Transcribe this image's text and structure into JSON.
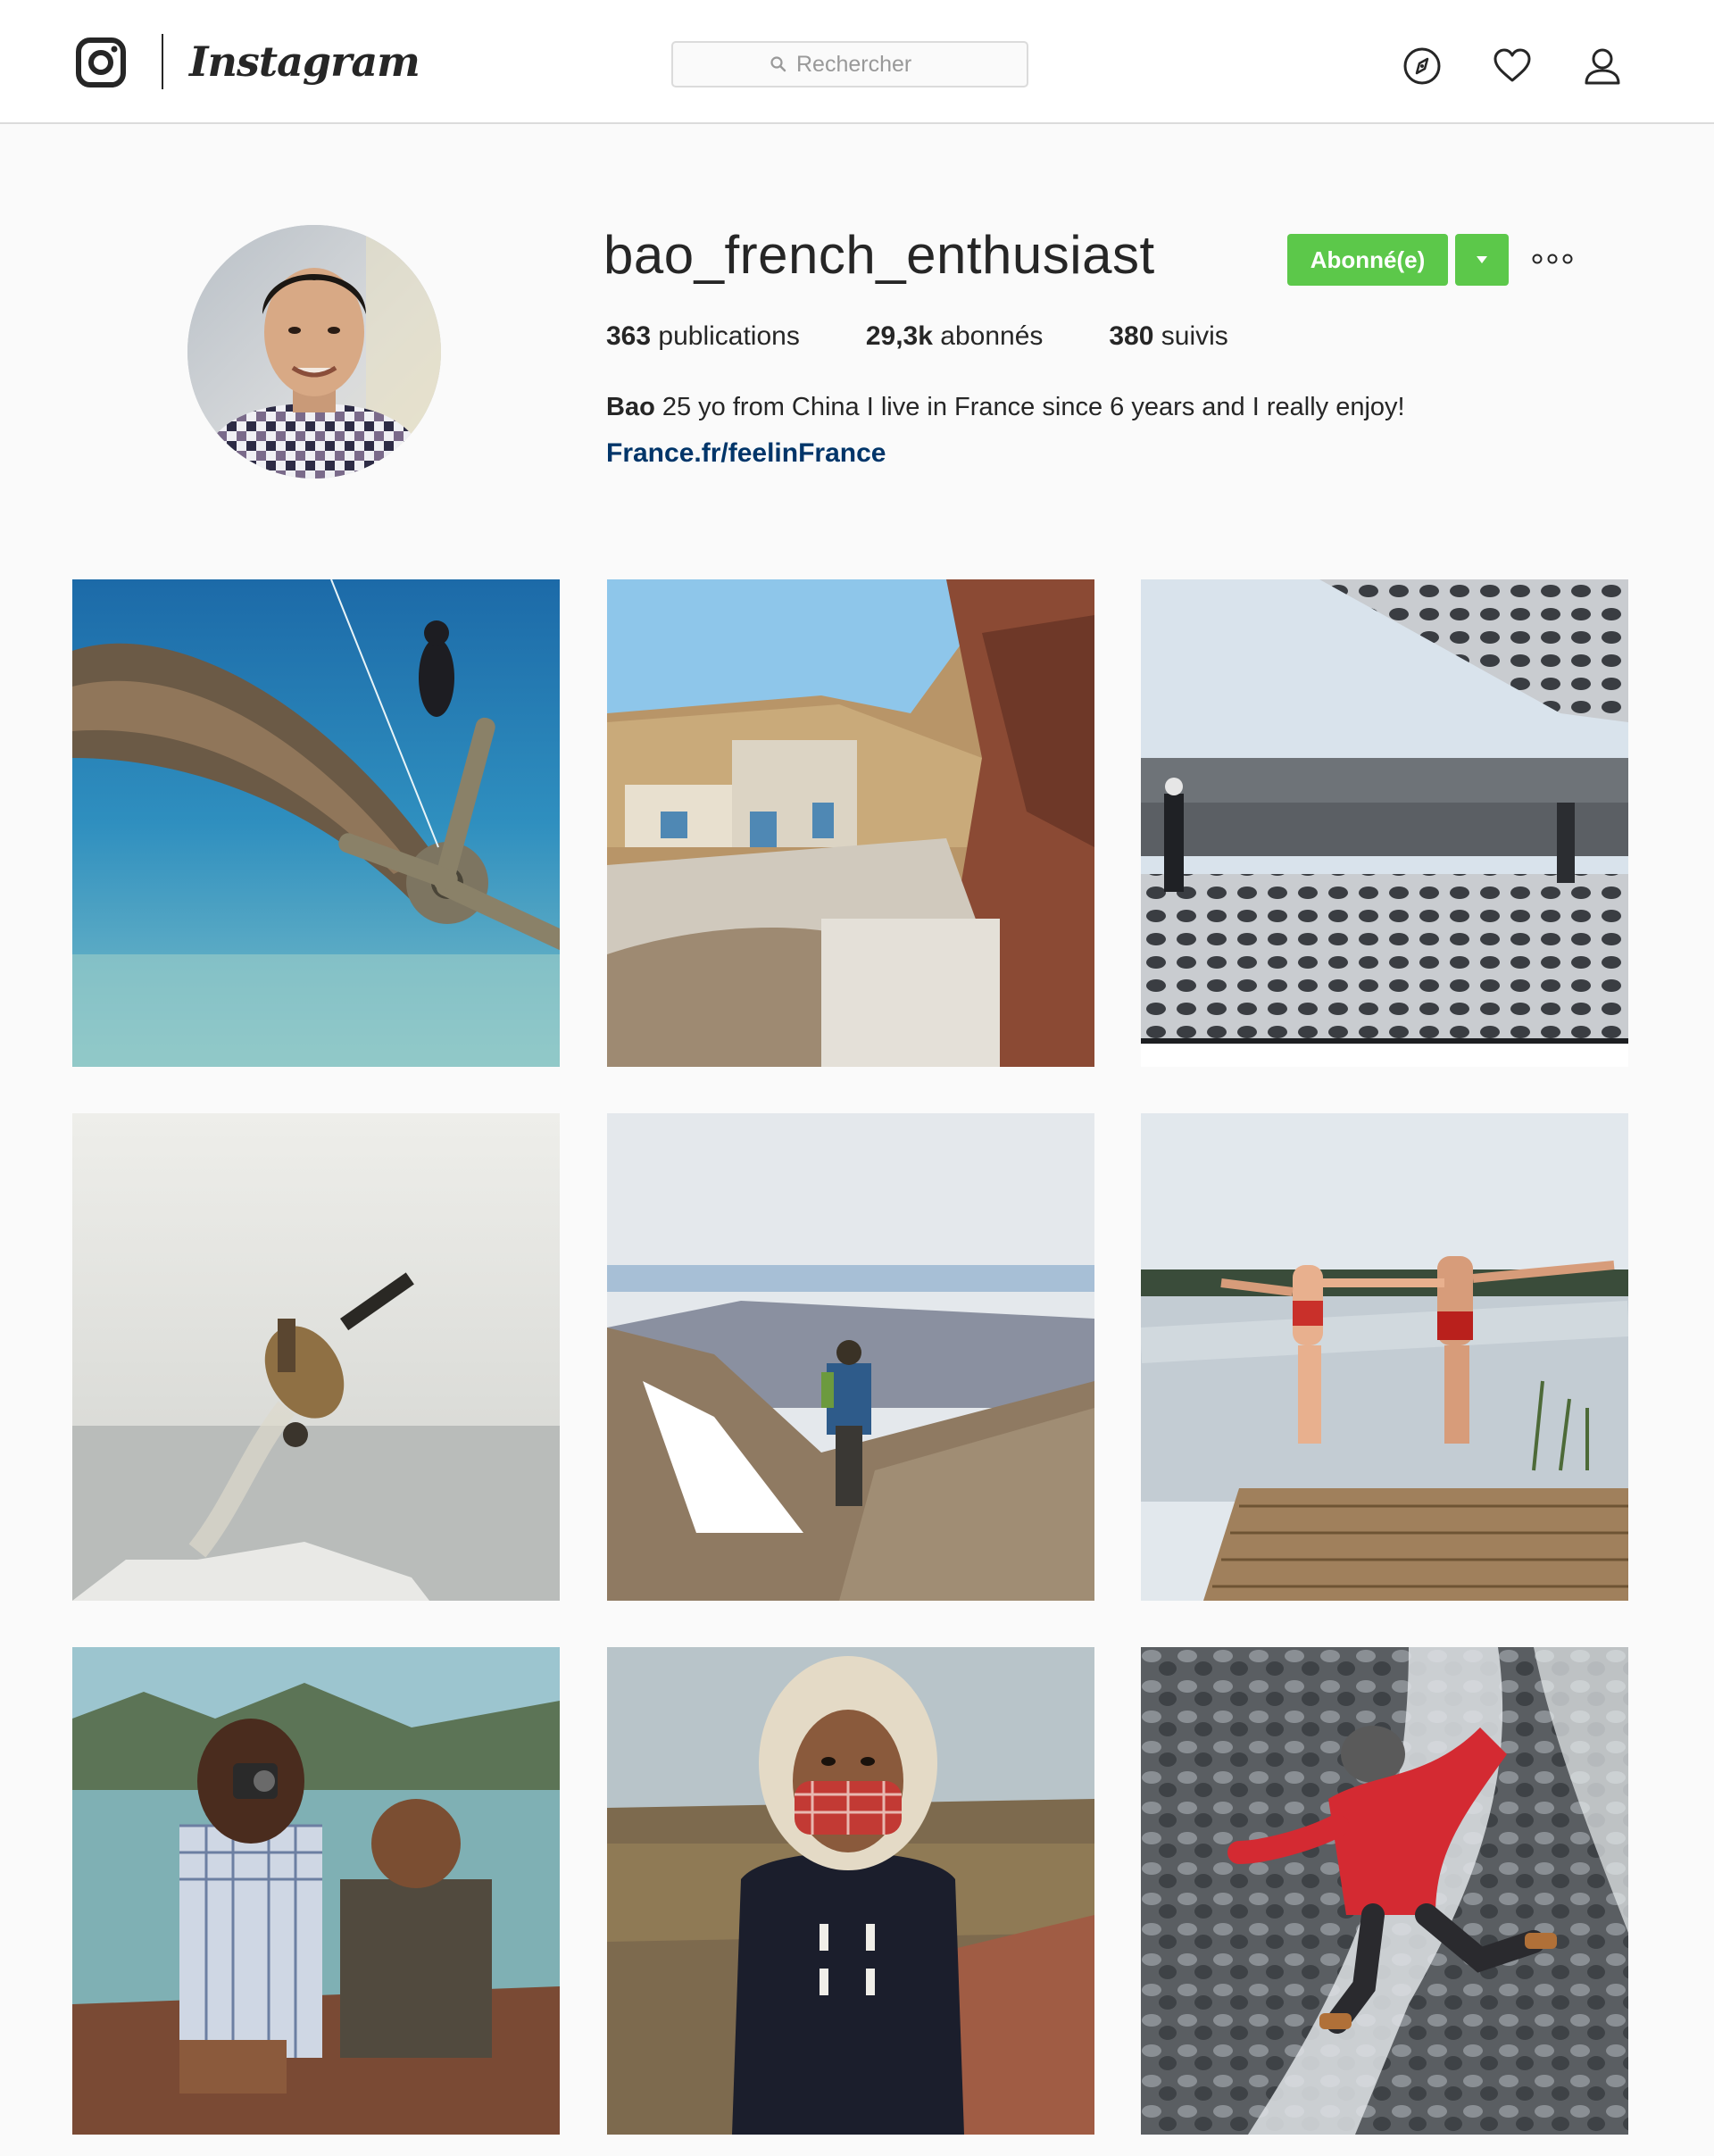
{
  "header": {
    "brand_name": "Instagram",
    "search_placeholder": "Rechercher",
    "nav_icons": [
      "compass-icon",
      "heart-icon",
      "user-icon"
    ]
  },
  "profile": {
    "username": "bao_french_enthusiast",
    "follow_label": "Abonné(e)",
    "stats": {
      "posts_count": "363",
      "posts_label": "publications",
      "followers_count": "29,3k",
      "followers_label": "abonnés",
      "following_count": "380",
      "following_label": "suivis"
    },
    "bio_name": "Bao",
    "bio_text": "25 yo from China I live in France since 6 years and I really enjoy!",
    "website": "France.fr/feelinFrance"
  },
  "colors": {
    "follow_green": "#5cc84a",
    "link_blue": "#003569",
    "background": "#fafafa",
    "border": "#dbdbdb"
  },
  "posts": [
    {
      "subject": "underwater-plane-wreck-diver"
    },
    {
      "subject": "coastal-village-cliffs"
    },
    {
      "subject": "modern-building-lattice-shadow"
    },
    {
      "subject": "snowboarder-backflip"
    },
    {
      "subject": "hiker-mountain-ridge"
    },
    {
      "subject": "couple-jumping-into-lake"
    },
    {
      "subject": "girl-with-camera-by-sea"
    },
    {
      "subject": "woman-hooded-red-scarf"
    },
    {
      "subject": "man-red-jacket-river-rocks"
    }
  ]
}
